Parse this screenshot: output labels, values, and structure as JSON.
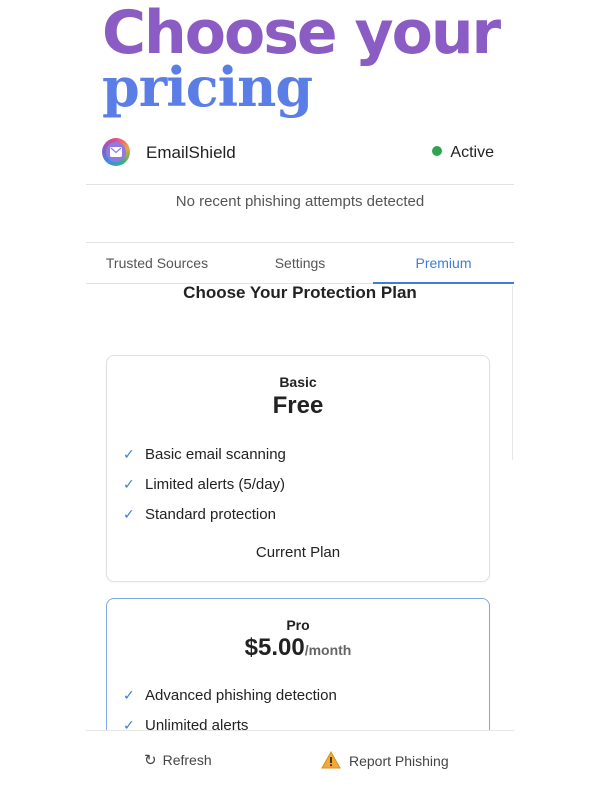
{
  "hero": {
    "line1": "Choose your",
    "line2": "pricing"
  },
  "header": {
    "app_name": "EmailShield",
    "status": "Active",
    "logo_icon": "envelope-icon",
    "status_color": "#2ea44f"
  },
  "notice": {
    "text": "No recent phishing attempts detected"
  },
  "tabs": [
    {
      "label": "Trusted Sources",
      "active": false
    },
    {
      "label": "Settings",
      "active": false
    },
    {
      "label": "Premium",
      "active": true
    }
  ],
  "premium": {
    "title": "Choose Your Protection Plan",
    "plans": [
      {
        "name": "Basic",
        "price": "Free",
        "features": [
          "Basic email scanning",
          "Limited alerts (5/day)",
          "Standard protection"
        ],
        "action": "Current Plan"
      },
      {
        "name": "Pro",
        "price": "$5.00",
        "price_unit": "/month",
        "features": [
          "Advanced phishing detection",
          "Unlimited alerts"
        ]
      }
    ]
  },
  "footer": {
    "refresh_label": "Refresh",
    "report_label": "Report Phishing",
    "refresh_icon": "refresh-icon",
    "report_icon": "warning-icon"
  },
  "colors": {
    "accent": "#3b7ddd",
    "hero_purple": "#8a5cc4",
    "hero_blue": "#5b7de6"
  }
}
